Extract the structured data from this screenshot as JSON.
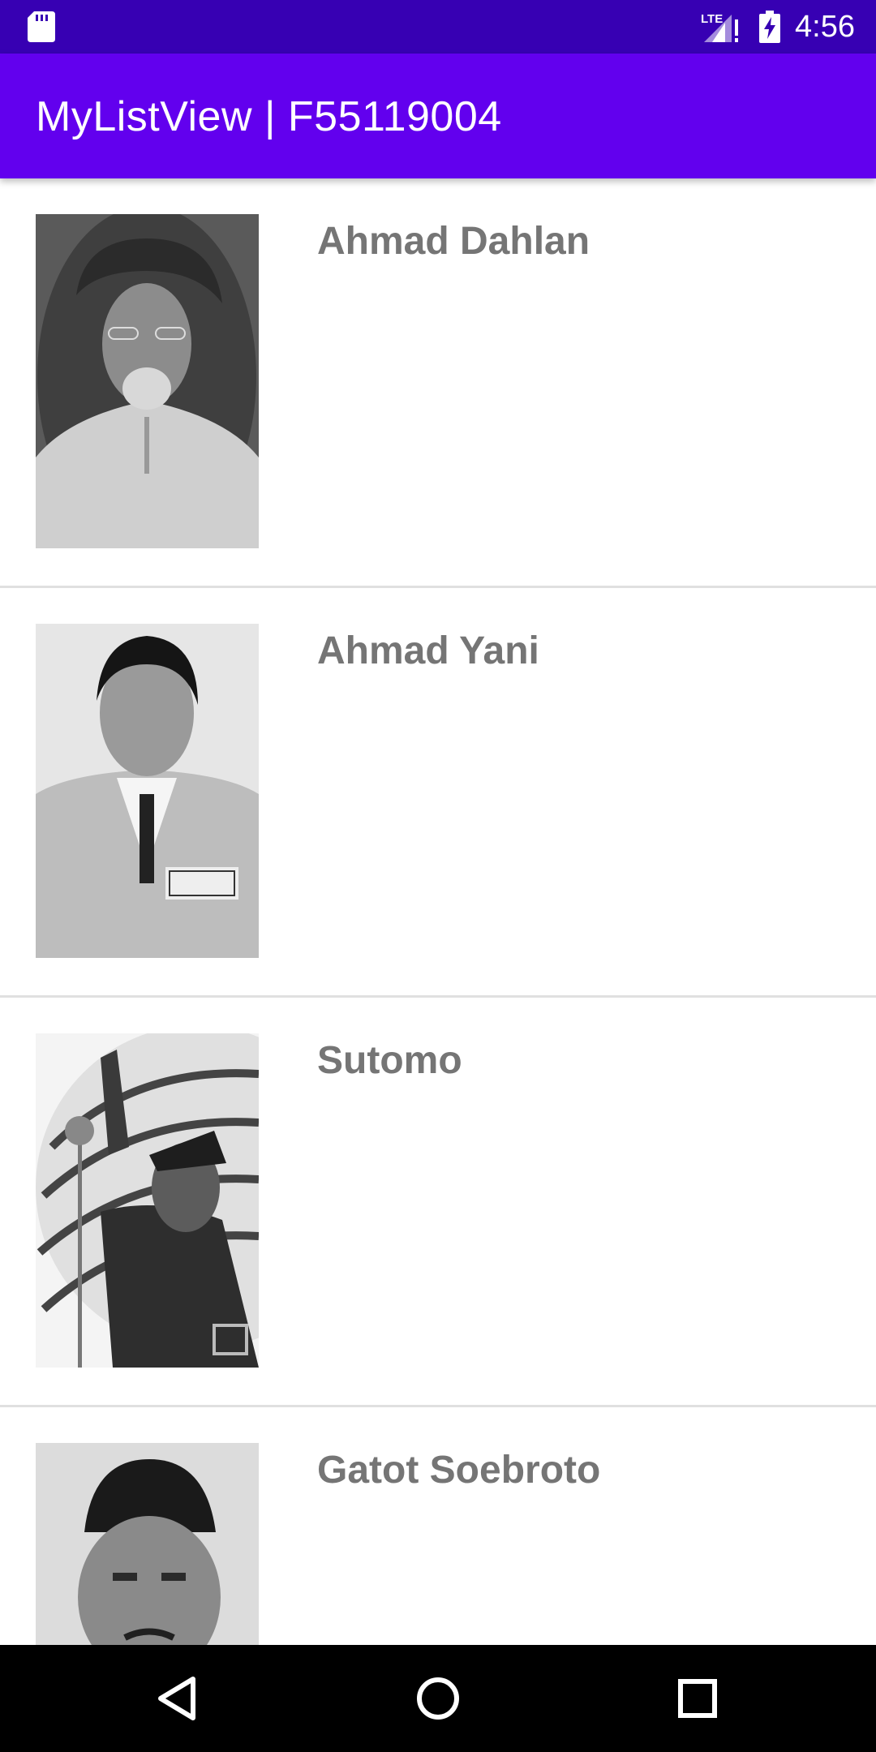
{
  "status_bar": {
    "time": "4:56",
    "network_label": "LTE",
    "icons": [
      "sd-card-icon",
      "signal-icon",
      "battery-charging-icon"
    ],
    "color": "#3700B3"
  },
  "app_bar": {
    "title": "MyListView | F55119004",
    "color": "#6200EE"
  },
  "list": {
    "items": [
      {
        "name": "Ahmad Dahlan",
        "image": "portrait-photo"
      },
      {
        "name": "Ahmad Yani",
        "image": "portrait-photo"
      },
      {
        "name": "Sutomo",
        "image": "portrait-photo"
      },
      {
        "name": "Gatot Soebroto",
        "image": "portrait-photo"
      }
    ],
    "name_color": "#757575"
  },
  "nav_bar": {
    "buttons": [
      "back-icon",
      "home-icon",
      "recents-icon"
    ]
  }
}
